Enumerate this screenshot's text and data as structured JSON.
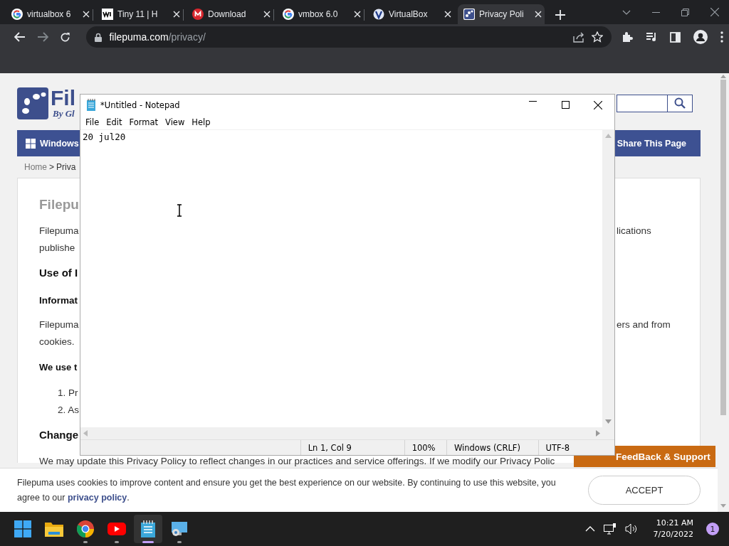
{
  "browser": {
    "tabs": [
      {
        "title": "virtualbox 6",
        "kind": "google",
        "selected": false
      },
      {
        "title": "Tiny 11 | H",
        "kind": "wix",
        "selected": false
      },
      {
        "title": "Download",
        "kind": "mega",
        "selected": false
      },
      {
        "title": "vmbox 6.0",
        "kind": "google",
        "selected": false
      },
      {
        "title": "VirtualBox",
        "kind": "virtualbox",
        "selected": false
      },
      {
        "title": "Privacy Poli",
        "kind": "filepuma",
        "selected": true
      }
    ],
    "address": {
      "host": "filepuma.com",
      "path": "/privacy/"
    }
  },
  "page": {
    "logo": {
      "name": "Fil",
      "tagline": "By Gl"
    },
    "nav": {
      "left": "Windows",
      "right": "Share This Page"
    },
    "breadcrumb": {
      "link": "Home",
      "separator": ">",
      "current": "Priva"
    },
    "lines": [
      {
        "kind": "title",
        "left": "Filepu"
      },
      {
        "kind": "para",
        "left": "Filepuma",
        "right": "lications"
      },
      {
        "kind": "line",
        "left": "publishe"
      },
      {
        "kind": "h2",
        "left": "Use of I"
      },
      {
        "kind": "h3",
        "left": "Informat"
      },
      {
        "kind": "para",
        "left": "Filepuma",
        "right": "ers and from"
      },
      {
        "kind": "line",
        "left": "cookies."
      },
      {
        "kind": "bold",
        "left": "We use t"
      },
      {
        "kind": "list",
        "left": "1. Pr"
      },
      {
        "kind": "item",
        "left": "2. As"
      },
      {
        "kind": "h2",
        "left": "Change"
      },
      {
        "kind": "notice",
        "left": "We may update this Privacy Policy to reflect changes in our practices and service offerings. If we modify our Privacy Polic"
      }
    ],
    "feedback": "FeedBack & Support",
    "cookie": {
      "text": "Filepuma uses cookies to improve content and ensure you get the best experience on our website. By continuing to use this website, you agree to our ",
      "link": "privacy policy",
      "after": ".",
      "button": "ACCEPT"
    }
  },
  "notepad": {
    "title": "*Untitled - Notepad",
    "menu": [
      "File",
      "Edit",
      "Format",
      "View",
      "Help"
    ],
    "text": "20 jul20",
    "status": [
      "Ln 1, Col 9",
      "100%",
      "Windows (CRLF)",
      "UTF-8"
    ]
  },
  "taskbar": {
    "apps": [
      {
        "kind": "start",
        "running": false,
        "selected": false
      },
      {
        "kind": "folder",
        "running": false,
        "selected": false
      },
      {
        "kind": "chrome",
        "running": true,
        "selected": false
      },
      {
        "kind": "youtube",
        "running": true,
        "selected": false
      },
      {
        "kind": "notepad",
        "running": true,
        "selected": true
      },
      {
        "kind": "remote",
        "running": true,
        "selected": false
      }
    ],
    "time": "10:21 AM",
    "date": "7/20/2022",
    "badge": "1"
  }
}
